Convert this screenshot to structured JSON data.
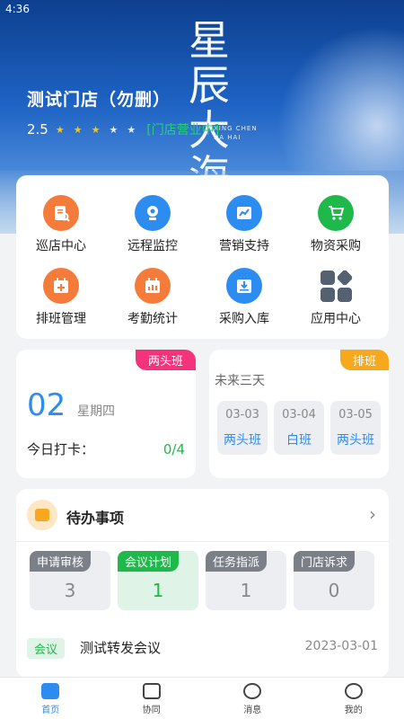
{
  "status_bar": {
    "time": "4:36"
  },
  "banner": {
    "store_name": "测试门店（勿删）",
    "rating": "2.5",
    "stars_total": 5,
    "stars_filled": 3,
    "store_status": "[门店营业中]",
    "logo_chars": [
      "星",
      "辰",
      "大",
      "海"
    ],
    "logo_small_1": "XING CHEN",
    "logo_small_2": "DA HAI"
  },
  "features": [
    {
      "label": "巡店中心",
      "icon": "store-inspection-icon"
    },
    {
      "label": "远程监控",
      "icon": "camera-icon"
    },
    {
      "label": "营销支持",
      "icon": "chart-icon"
    },
    {
      "label": "物资采购",
      "icon": "cart-icon"
    },
    {
      "label": "排班管理",
      "icon": "calendar-plus-icon"
    },
    {
      "label": "考勤统计",
      "icon": "calendar-stats-icon"
    },
    {
      "label": "采购入库",
      "icon": "inbox-download-icon"
    },
    {
      "label": "应用中心",
      "icon": "apps-grid-icon"
    }
  ],
  "today_shift": {
    "tag": "两头班",
    "day": "02",
    "weekday": "星期四",
    "punch_label": "今日打卡：",
    "punch_value": "0/4"
  },
  "future_shift": {
    "tag": "排班",
    "title": "未来三天",
    "days": [
      {
        "date": "03-03",
        "shift": "两头班"
      },
      {
        "date": "03-04",
        "shift": "白班"
      },
      {
        "date": "03-05",
        "shift": "两头班"
      }
    ]
  },
  "todo": {
    "title": "待办事项",
    "stats": [
      {
        "label": "申请审核",
        "value": "3",
        "active": false
      },
      {
        "label": "会议计划",
        "value": "1",
        "active": true
      },
      {
        "label": "任务指派",
        "value": "1",
        "active": false
      },
      {
        "label": "门店诉求",
        "value": "0",
        "active": false
      }
    ],
    "meeting": {
      "tag": "会议",
      "title": "测试转发会议",
      "date": "2023-03-01"
    }
  },
  "nav": [
    {
      "label": "首页",
      "active": true
    },
    {
      "label": "协同",
      "active": false
    },
    {
      "label": "消息",
      "active": false
    },
    {
      "label": "我的",
      "active": false
    }
  ],
  "colors": {
    "primary": "#2d8cf0",
    "success": "#1fb84b",
    "warning": "#f7a81c",
    "pink": "#f5337d",
    "orange": "#f57b3b"
  }
}
